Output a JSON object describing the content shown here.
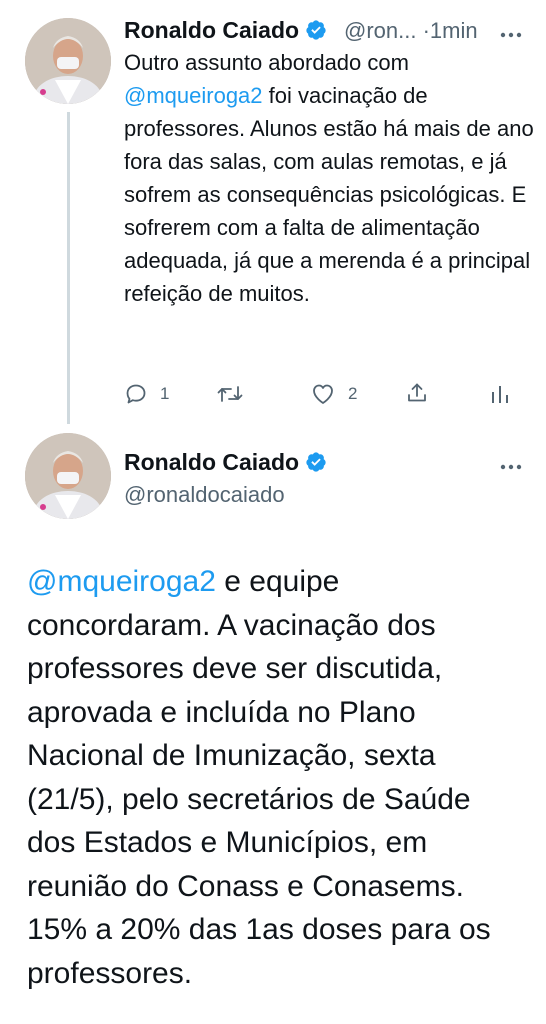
{
  "tweet1": {
    "author_name": "Ronaldo Caiado",
    "handle_truncated": "@ron...",
    "separator": "·",
    "time": "1min",
    "text_before_mention": "Outro assunto abordado com ",
    "mention": "@mqueiroga2",
    "text_after_mention": " foi vacinação de professores. Alunos estão há mais de  ano fora das salas, com aulas remotas, e já sofrem as consequências psicológicas. E sofrerem com a falta de alimentação adequada, já que a merenda é a principal refeição de muitos.",
    "actions": {
      "reply_count": "1",
      "retweet_count": "",
      "like_count": "2"
    },
    "icons": [
      "reply-icon",
      "retweet-icon",
      "heart-icon",
      "share-icon",
      "analytics-icon",
      "more-icon",
      "verified-icon"
    ]
  },
  "tweet2": {
    "author_name": "Ronaldo Caiado",
    "handle": "@ronaldocaiado",
    "mention": "@mqueiroga2",
    "text_after_mention": " e equipe concordaram. A vacinação dos professores deve ser discutida, aprovada e incluída no Plano Nacional de Imunização, sexta (21/5), pelo secretários de Saúde dos Estados e Municípios, em reunião do Conass e Conasems. 15% a 20% das 1as doses para os professores.",
    "icons": [
      "verified-icon",
      "more-icon"
    ]
  },
  "colors": {
    "link": "#1d9bf0",
    "verified": "#1d9bf0",
    "secondary_text": "#536471",
    "thread_line": "#cfd9de"
  }
}
